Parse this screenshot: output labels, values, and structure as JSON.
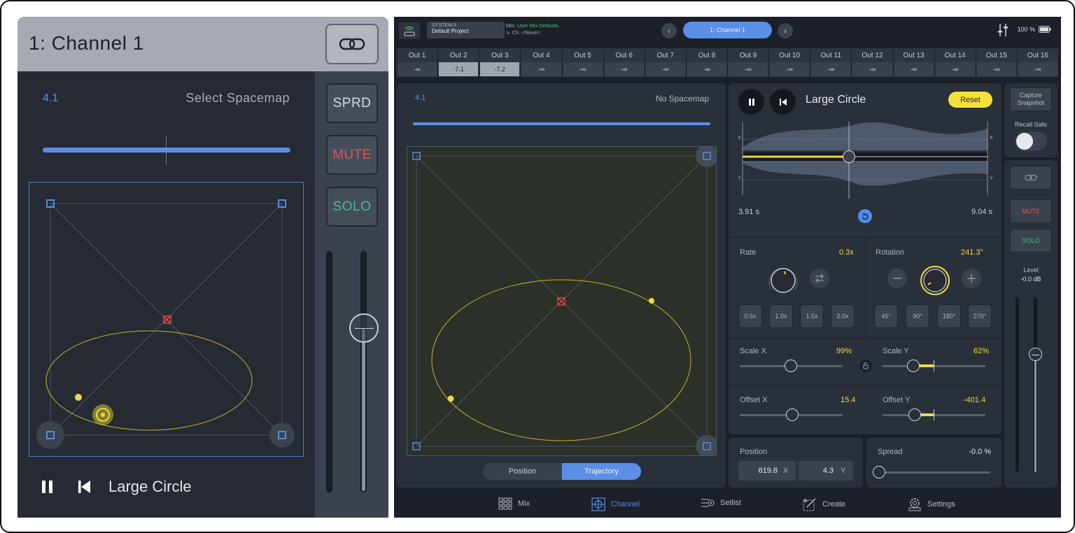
{
  "left_panel": {
    "title": "1:  Channel 1",
    "spacemap_number": "4.1",
    "spacemap_label": "Select Spacemap",
    "buttons": {
      "spread": "SPRD",
      "mute": "MUTE",
      "solo": "SOLO"
    },
    "transport_title": "Large Circle"
  },
  "topbar": {
    "system_label": "SYSTEM A",
    "project_name": "Default Project",
    "mix_prefix": "Mix:",
    "mix_name": "User Mix Defaults",
    "ch_line": "Ch: <None>",
    "channel_pill": "1: Channel 1",
    "battery": "100 %"
  },
  "outputs": [
    {
      "name": "Out 1",
      "value": "-∞"
    },
    {
      "name": "Out 2",
      "value": "-7.1"
    },
    {
      "name": "Out 3",
      "value": "-7.2"
    },
    {
      "name": "Out 4",
      "value": "-∞"
    },
    {
      "name": "Out 5",
      "value": "-∞"
    },
    {
      "name": "Out 6",
      "value": "-∞"
    },
    {
      "name": "Out 7",
      "value": "-∞"
    },
    {
      "name": "Out 8",
      "value": "-∞"
    },
    {
      "name": "Out 9",
      "value": "-∞"
    },
    {
      "name": "Out 10",
      "value": "-∞"
    },
    {
      "name": "Out 11",
      "value": "-∞"
    },
    {
      "name": "Out 12",
      "value": "-∞"
    },
    {
      "name": "Out 13",
      "value": "-∞"
    },
    {
      "name": "Out 14",
      "value": "-∞"
    },
    {
      "name": "Out 15",
      "value": "-∞"
    },
    {
      "name": "Out 16",
      "value": "-∞"
    }
  ],
  "pad_panel": {
    "spacemap_number": "4.1",
    "spacemap_label": "No Spacemap",
    "segments": {
      "position": "Position",
      "trajectory": "Trajectory"
    }
  },
  "trajectory": {
    "title": "Large Circle",
    "reset_label": "Reset",
    "axis_x": "X",
    "axis_y": "Y",
    "time_start": "3.91 s",
    "time_end": "9.04 s",
    "rate": {
      "label": "Rate",
      "value": "0.3x",
      "presets": [
        "0.5x",
        "1.0x",
        "1.5x",
        "2.0x"
      ]
    },
    "rotation": {
      "label": "Rotation",
      "value": "241.3°",
      "presets": [
        "45°",
        "90°",
        "180°",
        "270°"
      ]
    },
    "scale_x": {
      "label": "Scale X",
      "value": "99%"
    },
    "scale_y": {
      "label": "Scale Y",
      "value": "62%"
    },
    "offset_x": {
      "label": "Offset X",
      "value": "15.4"
    },
    "offset_y": {
      "label": "Offset Y",
      "value": "-401.4"
    }
  },
  "position": {
    "label": "Position",
    "x": "619.8",
    "x_axis": "X",
    "y": "4.3",
    "y_axis": "Y"
  },
  "spread": {
    "label": "Spread",
    "value": "-0.0 %"
  },
  "right_strip": {
    "capture_line1": "Capture",
    "capture_line2": "Snapshot",
    "recall_safe": "Recall Safe",
    "mute": "MUTE",
    "solo": "SOLO",
    "level_label": "Level",
    "level_value": "-0.0 dB"
  },
  "tabs": {
    "mix": "Mix",
    "channel": "Channel",
    "setlist": "Setlist",
    "create": "Create",
    "settings": "Settings"
  },
  "colors": {
    "accent": "#5b8fe6",
    "yellow": "#f3e03b",
    "mute_red": "#e25555",
    "solo_green": "#3cc48a",
    "bg": "#1c2028"
  }
}
